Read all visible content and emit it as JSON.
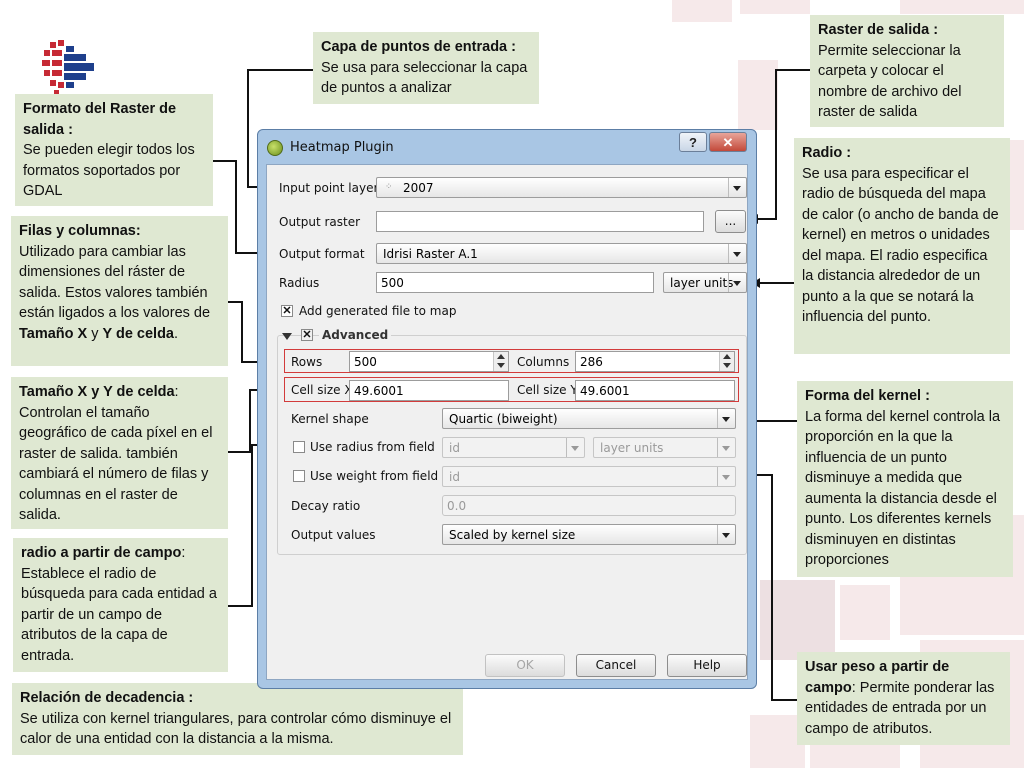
{
  "dialog": {
    "title": "Heatmap Plugin",
    "help_btn": "?",
    "close_btn": "✕",
    "input_layer": {
      "label": "Input point layer",
      "value": "2007"
    },
    "output_raster": {
      "label": "Output raster",
      "value": "",
      "browse": "..."
    },
    "output_format": {
      "label": "Output format",
      "value": "Idrisi Raster A.1"
    },
    "radius": {
      "label": "Radius",
      "value": "500",
      "unit": "layer units"
    },
    "add_to_map": {
      "label": "Add generated file to map",
      "checked": true
    },
    "advanced": {
      "label": "Advanced"
    },
    "rows": {
      "label": "Rows",
      "value": "500"
    },
    "columns": {
      "label": "Columns",
      "value": "286"
    },
    "cell_x": {
      "label": "Cell size X",
      "value": "49.6001"
    },
    "cell_y": {
      "label": "Cell size Y",
      "value": "49.6001"
    },
    "kernel_shape": {
      "label": "Kernel shape",
      "value": "Quartic (biweight)"
    },
    "radius_field": {
      "label": "Use radius from field",
      "value": "id",
      "unit": "layer units"
    },
    "weight_field": {
      "label": "Use weight from field",
      "value": "id"
    },
    "decay_ratio": {
      "label": "Decay ratio",
      "value": "0.0"
    },
    "output_values": {
      "label": "Output values",
      "value": "Scaled by kernel size"
    },
    "buttons": {
      "ok": "OK",
      "cancel": "Cancel",
      "help": "Help"
    }
  },
  "notes": {
    "capa": {
      "title": "Capa de puntos de entrada :",
      "body": "Se usa para seleccionar la capa de puntos a analizar"
    },
    "formato": {
      "title": "Formato del Raster de salida :",
      "body": "Se pueden elegir todos los formatos soportados por GDAL"
    },
    "filas": {
      "title": "Filas y columnas:",
      "body_a": "Utilizado para cambiar las dimensiones del ráster de salida. Estos valores también están ligados a los valores de ",
      "bold1": "Tamaño X",
      "mid": " y ",
      "bold2": "Y de celda",
      "end": "."
    },
    "tamano": {
      "title": "Tamaño X y Y de celda",
      "body": ": Controlan el tamaño geográfico de cada píxel en el raster de salida. también cambiará el número de filas y columnas en el raster de salida."
    },
    "radio_campo": {
      "title": "radio a partir de campo",
      "body": ": Establece el radio de búsqueda para cada entidad a partir de un campo de atributos de la capa de entrada."
    },
    "decadencia": {
      "title": "Relación de decadencia :",
      "body": "Se utiliza con kernel triangulares, para controlar cómo disminuye el calor de una entidad con la distancia a la misma."
    },
    "raster_salida": {
      "title": "Raster de salida :",
      "body": "Permite seleccionar la carpeta y colocar el nombre de archivo del raster de salida"
    },
    "radio": {
      "title": "Radio :",
      "body": "Se usa para especificar el radio de búsqueda del mapa de calor (o ancho de banda de kernel) en metros o unidades del mapa. El radio especifica la distancia alrededor de un punto a la que se notará la influencia del punto."
    },
    "kernel": {
      "title": "Forma del kernel :",
      "body": "La forma del kernel controla la proporción en la que la influencia de un punto disminuye a medida que aumenta la distancia desde el punto. Los diferentes kernels disminuyen en distintas proporciones"
    },
    "peso": {
      "title": "Usar peso a partir de campo",
      "body": ": Permite ponderar las entidades de entrada por un campo de atributos."
    }
  }
}
